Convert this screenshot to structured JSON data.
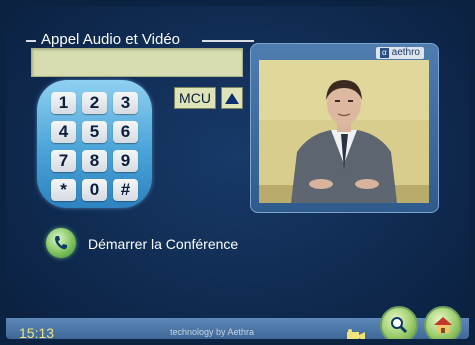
{
  "panel": {
    "title": "Appel Audio et Vidéo",
    "dial_value": ""
  },
  "keypad": {
    "keys": [
      "1",
      "2",
      "3",
      "4",
      "5",
      "6",
      "7",
      "8",
      "9",
      "*",
      "0",
      "#"
    ]
  },
  "mcu": {
    "label": "MCU"
  },
  "video": {
    "brand": "aethro",
    "brand_logo": "α"
  },
  "call": {
    "label": "Démarrer la Conférence"
  },
  "footer": {
    "time": "15:13",
    "credit": "technology by Aethra"
  },
  "colors": {
    "accent_green": "#7fc25c",
    "clock": "#f1e27c",
    "field": "#d7ddb0"
  },
  "icons": {
    "call": "phone-icon",
    "camera": "camera-icon",
    "search": "magnifier-icon",
    "home": "home-icon"
  }
}
